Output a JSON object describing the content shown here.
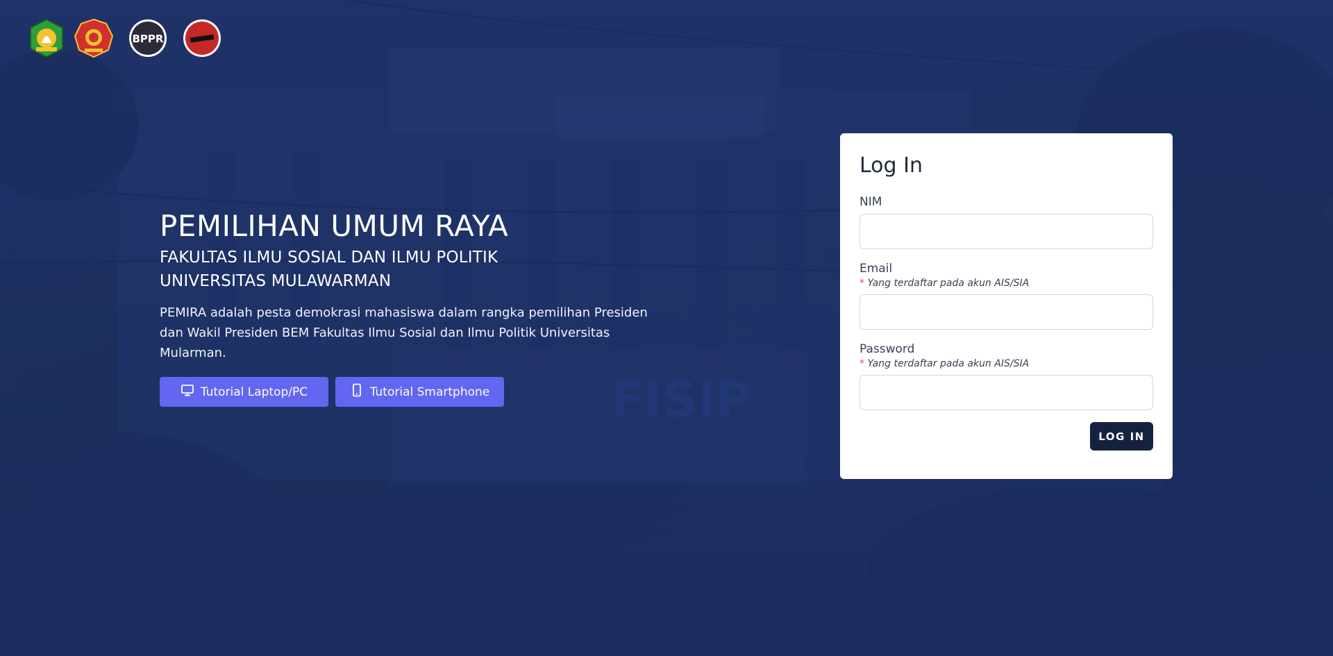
{
  "logos": [
    {
      "name": "university-seal-green",
      "color": "#2e9e3a"
    },
    {
      "name": "faculty-seal-red",
      "color": "#d32f2f"
    },
    {
      "name": "bppr-logo",
      "text": "BPPR",
      "color": "#ffffff"
    },
    {
      "name": "panwaslu-logo",
      "color": "#c62828"
    }
  ],
  "hero": {
    "title": "PEMILIHAN UMUM RAYA",
    "subtitle_line1": "FAKULTAS ILMU SOSIAL DAN ILMU POLITIK",
    "subtitle_line2": "UNIVERSITAS MULAWARMAN",
    "description": "PEMIRA adalah pesta demokrasi mahasiswa dalam rangka pemilihan Presiden dan Wakil Presiden BEM Fakultas Ilmu Sosial dan Ilmu Politik Universitas Mularman.",
    "buttons": {
      "laptop_label": "Tutorial Laptop/PC",
      "phone_label": "Tutorial Smartphone"
    }
  },
  "login": {
    "title": "Log In",
    "nim": {
      "label": "NIM",
      "value": ""
    },
    "email": {
      "label": "Email",
      "hint_star": "*",
      "hint": " Yang terdaftar pada akun AIS/SIA",
      "value": ""
    },
    "password": {
      "label": "Password",
      "hint_star": "*",
      "hint": " Yang terdaftar pada akun AIS/SIA",
      "value": ""
    },
    "submit_label": "LOG IN"
  },
  "colors": {
    "accent": "#6366f1",
    "login_button": "#15223f",
    "background_tint": "#1f3368"
  }
}
